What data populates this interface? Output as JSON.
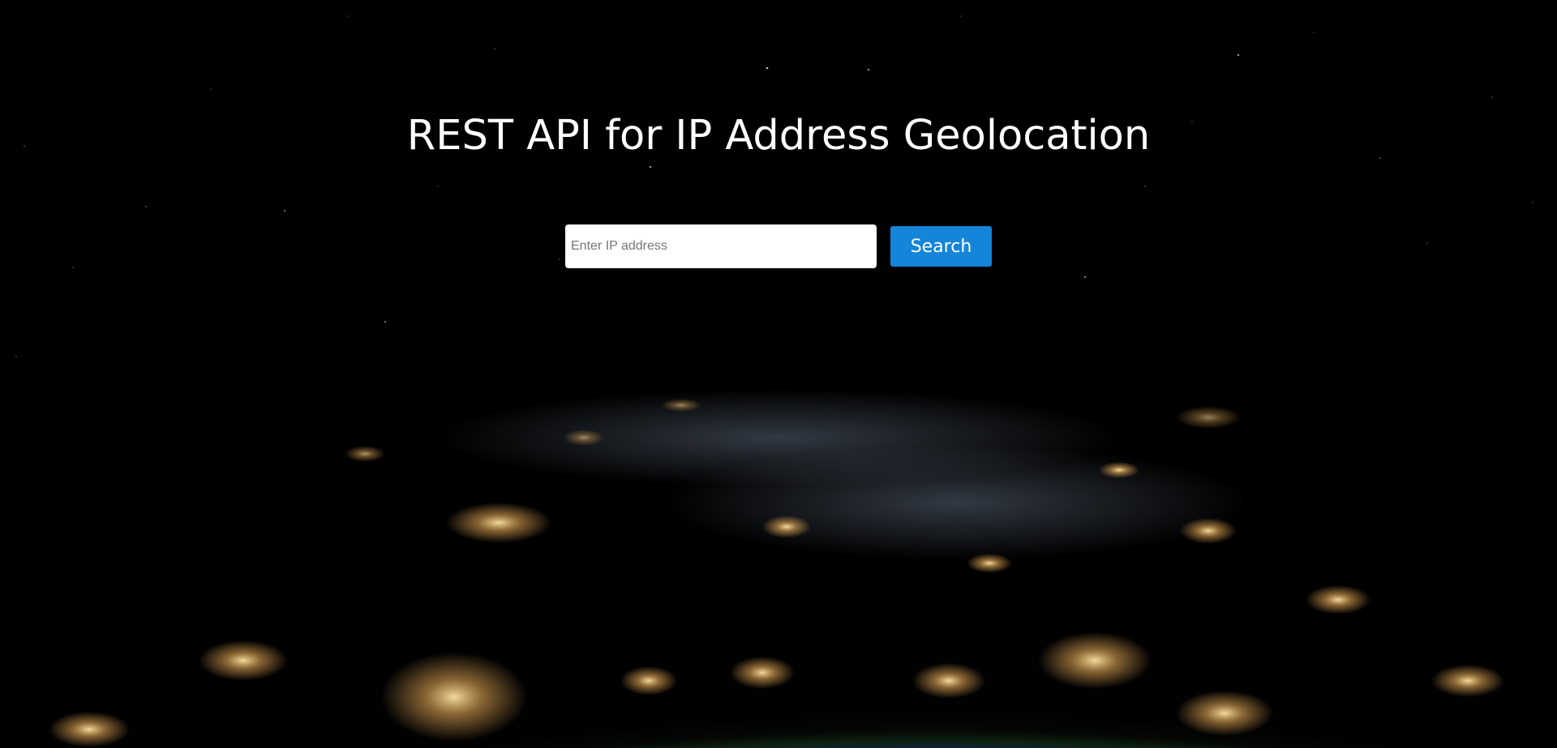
{
  "hero": {
    "title": "REST API for IP Address Geolocation",
    "background_image": "earth-at-night-from-space"
  },
  "search": {
    "placeholder": "Enter IP address",
    "value": "",
    "button_label": "Search"
  },
  "colors": {
    "background": "#000000",
    "button": "#1485d8",
    "title_text": "#ffffff"
  }
}
